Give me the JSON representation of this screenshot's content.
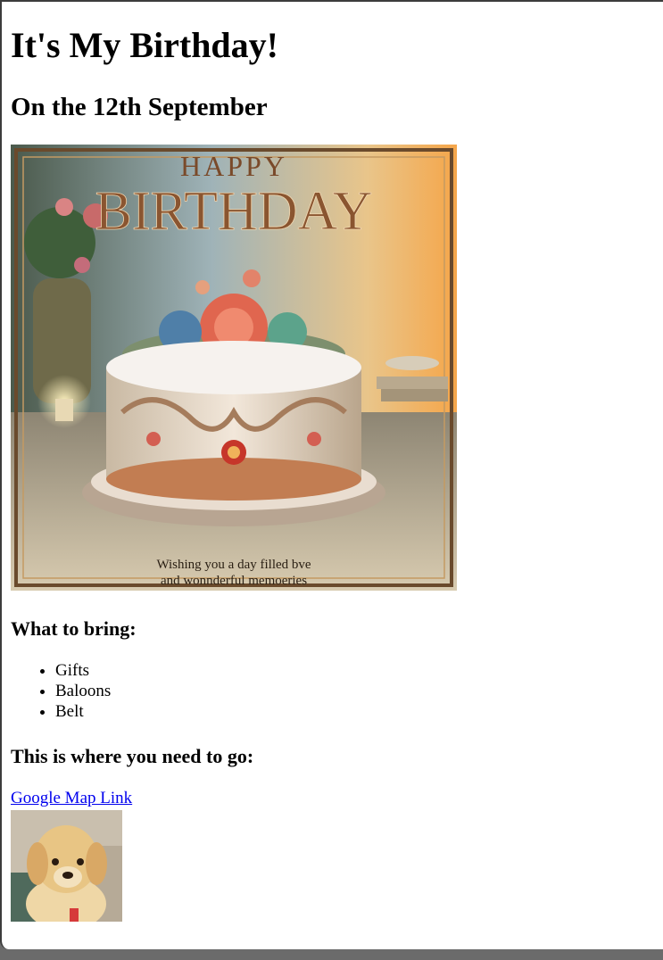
{
  "page": {
    "title": "It's My Birthday!",
    "date_line": "On the 12th September"
  },
  "hero_image": {
    "headline_top": "HAPPY",
    "headline_main": "BIRTHDAY",
    "caption_line1": "Wishing you a day filled bve",
    "caption_line2": "and wonnderful memoeries"
  },
  "bring": {
    "heading": "What to bring:",
    "items": [
      "Gifts",
      "Baloons",
      "Belt"
    ]
  },
  "directions": {
    "heading": "This is where you need to go:",
    "link_label": "Google Map Link"
  },
  "colors": {
    "link": "#0000ee",
    "frame": "#3c3c3c",
    "backdrop": "#6b6b6b"
  }
}
